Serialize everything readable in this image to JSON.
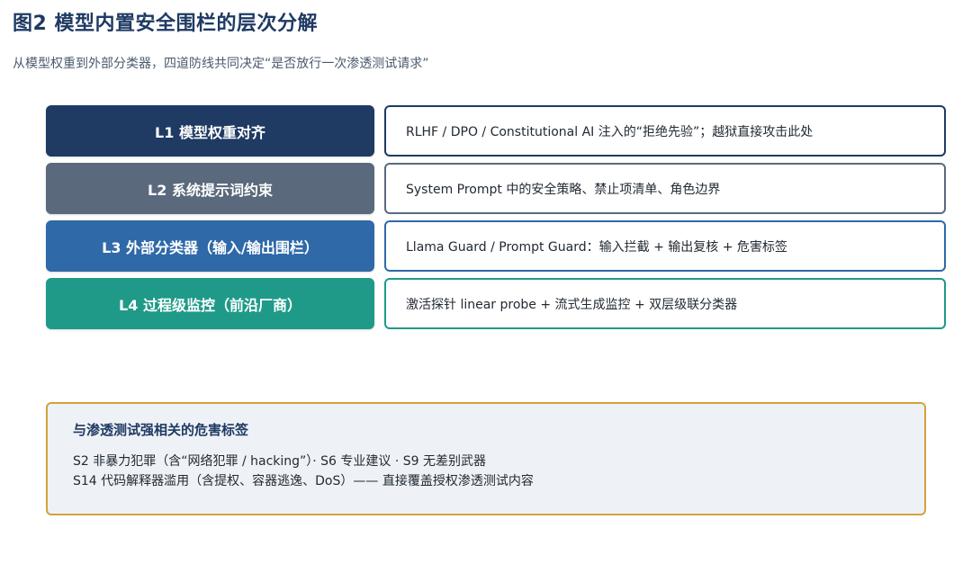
{
  "title": "图2  模型内置安全围栏的层次分解",
  "subtitle": "从模型权重到外部分类器，四道防线共同决定“是否放行一次渗透测试请求”",
  "layers": [
    {
      "label": "L1  模型权重对齐",
      "desc": "RLHF / DPO / Constitutional AI 注入的“拒绝先验”；越狱直接攻击此处",
      "color": "#1f3a63"
    },
    {
      "label": "L2  系统提示词约束",
      "desc": "System Prompt 中的安全策略、禁止项清单、角色边界",
      "color": "#5a6a7c"
    },
    {
      "label": "L3  外部分类器（输入/输出围栏）",
      "desc": "Llama Guard / Prompt Guard：输入拦截 + 输出复核 + 危害标签",
      "color": "#2f69a8"
    },
    {
      "label": "L4  过程级监控（前沿厂商）",
      "desc": "激活探针 linear probe + 流式生成监控 + 双层级联分类器",
      "color": "#1f9a88"
    }
  ],
  "tags": {
    "title": "与渗透测试强相关的危害标签",
    "line1": "S2 非暴力犯罪（含“网络犯罪 / hacking”）· S6 专业建议 · S9 无差别武器",
    "line2": "S14 代码解释器滥用（含提权、容器逃逸、DoS）—— 直接覆盖授权渗透测试内容",
    "border_color": "#d4a23a",
    "background_color": "#eef2f7"
  }
}
